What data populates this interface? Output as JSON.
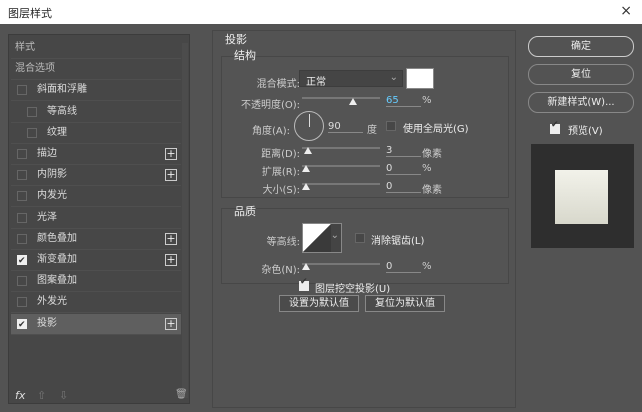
{
  "window": {
    "title": "图层样式",
    "close": "×"
  },
  "sidebar": {
    "items": [
      {
        "label": "样式",
        "type": "header"
      },
      {
        "label": "混合选项",
        "type": "header"
      },
      {
        "label": "斜面和浮雕",
        "checked": false
      },
      {
        "label": "等高线",
        "checked": false,
        "indent": true
      },
      {
        "label": "纹理",
        "checked": false,
        "indent": true
      },
      {
        "label": "描边",
        "checked": false,
        "plus": true
      },
      {
        "label": "内阴影",
        "checked": false,
        "plus": true
      },
      {
        "label": "内发光",
        "checked": false
      },
      {
        "label": "光泽",
        "checked": false
      },
      {
        "label": "颜色叠加",
        "checked": false,
        "plus": true
      },
      {
        "label": "渐变叠加",
        "checked": true,
        "plus": true
      },
      {
        "label": "图案叠加",
        "checked": false
      },
      {
        "label": "外发光",
        "checked": false
      },
      {
        "label": "投影",
        "checked": true,
        "plus": true,
        "selected": true
      }
    ],
    "fx": "fx",
    "up": "⇧",
    "down": "⇩",
    "trash": "🗑"
  },
  "main": {
    "section_title": "投影",
    "structure": {
      "title": "结构",
      "blend_mode_label": "混合模式:",
      "blend_mode": "正常",
      "shadow_color": "#ffffff",
      "opacity_label": "不透明度(O):",
      "opacity": "65",
      "opacity_unit": "%",
      "opacity_fraction": 0.65,
      "angle_label": "角度(A):",
      "angle": "90",
      "angle_unit": "度",
      "global_light_label": "使用全局光(G)",
      "global_light": false,
      "distance_label": "距离(D):",
      "distance": "3",
      "distance_unit": "像素",
      "spread_label": "扩展(R):",
      "spread": "0",
      "spread_unit": "%",
      "size_label": "大小(S):",
      "size": "0",
      "size_unit": "像素"
    },
    "quality": {
      "title": "品质",
      "contour_label": "等高线:",
      "antialias_label": "消除锯齿(L)",
      "antialias": false,
      "noise_label": "杂色(N):",
      "noise": "0",
      "noise_unit": "%"
    },
    "knockout_label": "图层挖空投影(U)",
    "knockout": true,
    "make_default": "设置为默认值",
    "reset_default": "复位为默认值"
  },
  "right": {
    "ok": "确定",
    "reset": "复位",
    "new_style": "新建样式(W)...",
    "preview_label": "预览(V)",
    "preview": true
  }
}
